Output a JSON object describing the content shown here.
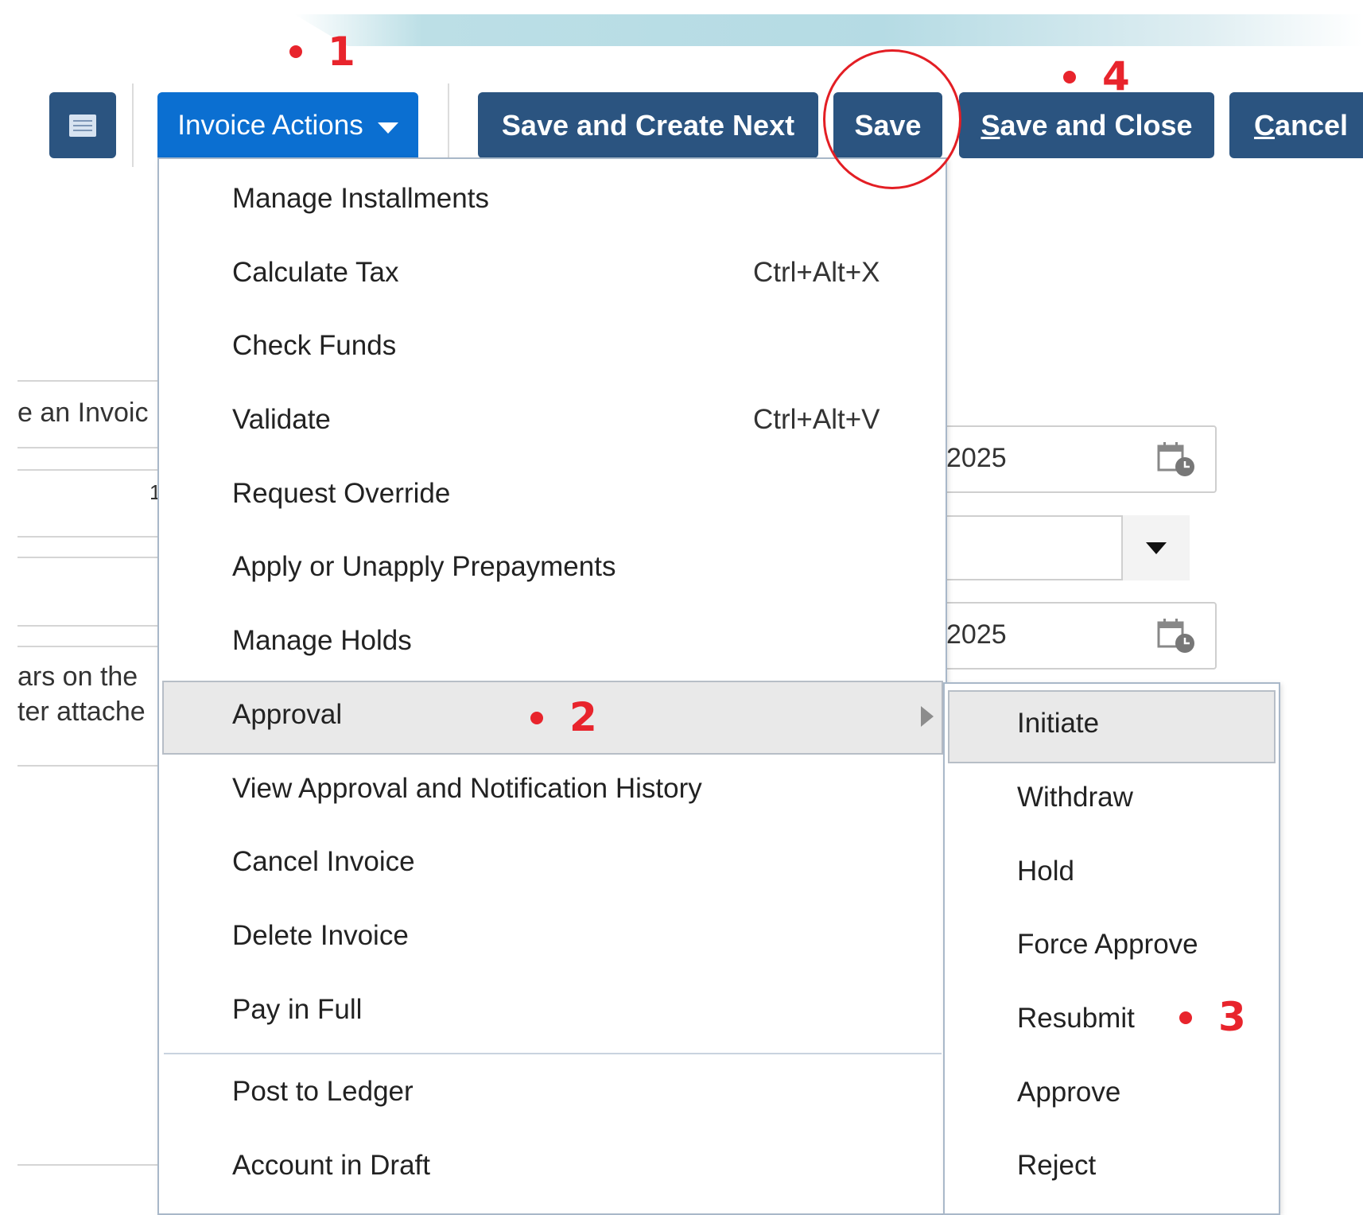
{
  "toolbar": {
    "invoice_actions_label": "Invoice Actions",
    "save_and_create_next_label": "Save and Create Next",
    "save_label": "Save",
    "save_and_close_prefix": "S",
    "save_and_close_rest": "ave and Close",
    "cancel_prefix": "C",
    "cancel_rest": "ancel"
  },
  "background": {
    "fragment_1": "e an Invoic",
    "fragment_2": "ars on the",
    "fragment_3": "ter attache",
    "date_field_1": "2025",
    "date_field_2": "2025",
    "stray_char": "1"
  },
  "invoice_actions_menu": {
    "items": [
      {
        "label": "Manage Installments",
        "shortcut": ""
      },
      {
        "label": "Calculate Tax",
        "shortcut": "Ctrl+Alt+X"
      },
      {
        "label": "Check Funds",
        "shortcut": ""
      },
      {
        "label": "Validate",
        "shortcut": "Ctrl+Alt+V"
      },
      {
        "label": "Request Override",
        "shortcut": ""
      },
      {
        "label": "Apply or Unapply Prepayments",
        "shortcut": ""
      },
      {
        "label": "Manage Holds",
        "shortcut": ""
      },
      {
        "label": "Approval",
        "shortcut": ""
      },
      {
        "label": "View Approval and Notification History",
        "shortcut": ""
      },
      {
        "label": "Cancel Invoice",
        "shortcut": ""
      },
      {
        "label": "Delete Invoice",
        "shortcut": ""
      },
      {
        "label": "Pay in Full",
        "shortcut": ""
      },
      {
        "label": "Post to Ledger",
        "shortcut": ""
      },
      {
        "label": "Account in Draft",
        "shortcut": ""
      }
    ]
  },
  "approval_submenu": {
    "items": [
      "Initiate",
      "Withdraw",
      "Hold",
      "Force Approve",
      "Resubmit",
      "Approve",
      "Reject"
    ]
  },
  "annotations": {
    "step_1": "1",
    "step_2": "2",
    "step_3": "3",
    "step_4": "4"
  },
  "colors": {
    "toolbar_button": "#2b5480",
    "invoice_actions_button": "#0b6fd1",
    "annotation_red": "#e8242c"
  }
}
